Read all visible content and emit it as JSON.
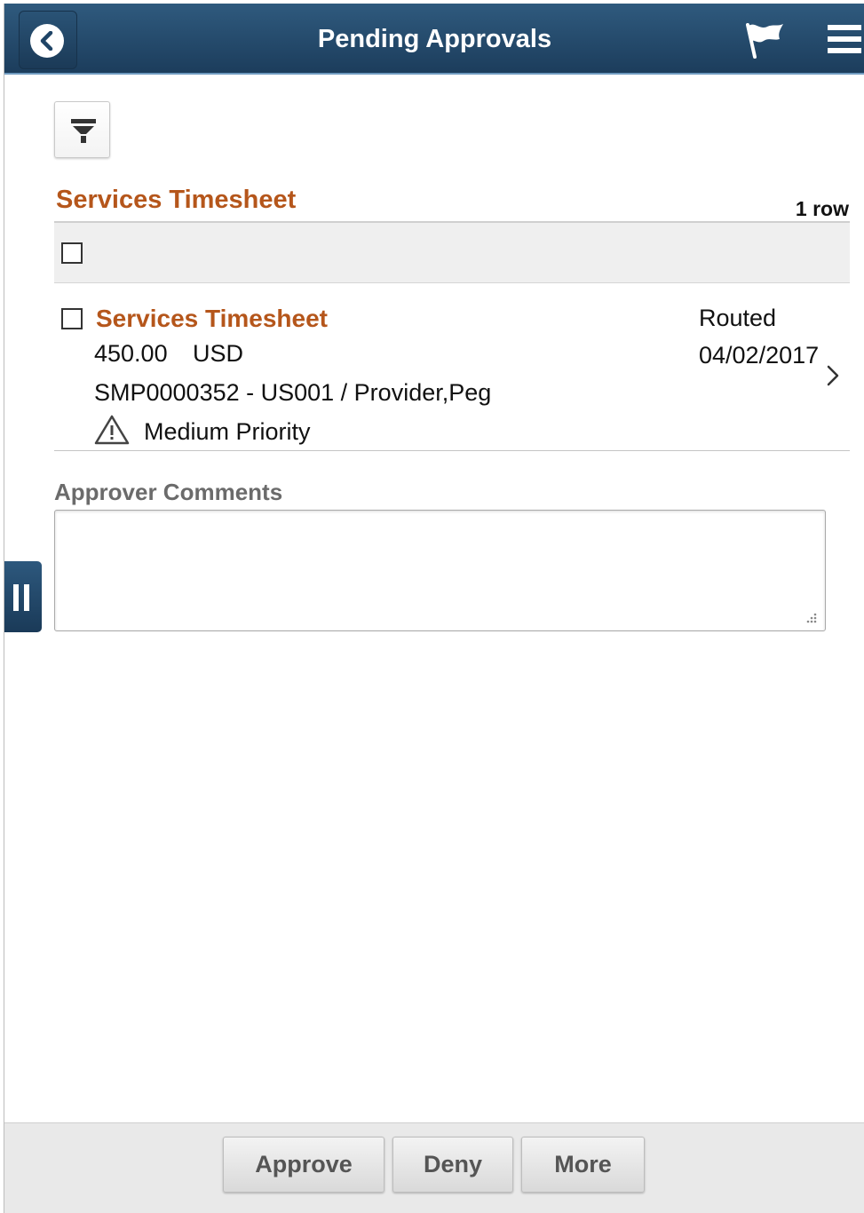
{
  "header": {
    "title": "Pending Approvals",
    "back_icon": "chevron-left-icon",
    "flag_icon": "flag-icon",
    "menu_icon": "hamburger-menu-icon",
    "bar_color": "#1f4466"
  },
  "filter": {
    "icon": "filter-icon"
  },
  "section": {
    "title": "Services Timesheet",
    "row_count": "1 row",
    "title_color": "#b5561b"
  },
  "items": [
    {
      "title": "Services Timesheet",
      "amount": "450.00",
      "currency": "USD",
      "description": "SMP0000352 - US001 / Provider,Peg",
      "priority": "Medium Priority",
      "status": "Routed",
      "date": "04/02/2017"
    }
  ],
  "comments": {
    "label": "Approver Comments",
    "value": "",
    "placeholder": ""
  },
  "footer": {
    "approve_label": "Approve",
    "deny_label": "Deny",
    "more_label": "More"
  }
}
